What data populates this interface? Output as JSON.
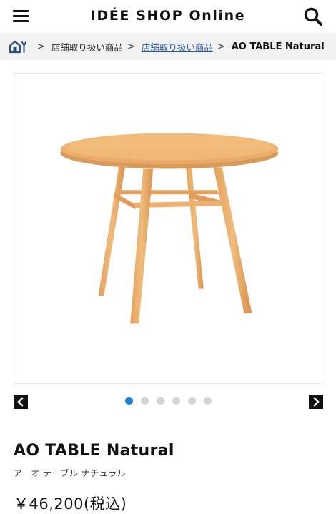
{
  "header": {
    "title": "IDÉE SHOP Online",
    "menu_icon": "hamburger-menu-icon",
    "search_icon": "search-icon"
  },
  "breadcrumb": {
    "home_icon": "home-icon",
    "separator": ">",
    "items": [
      {
        "label": "店舗取り扱い商品"
      },
      {
        "label": "店舗取り扱い商品"
      },
      {
        "label": "AO TABLE Natural"
      }
    ]
  },
  "carousel": {
    "prev_icon": "chevron-left-icon",
    "next_icon": "chevron-right-icon",
    "active_index": 0,
    "dots": 6,
    "active_color": "#1f7fd1"
  },
  "product": {
    "name": "AO TABLE Natural",
    "kana": "アーオ テーブル ナチュラル",
    "price": "￥46,200(税込)"
  }
}
